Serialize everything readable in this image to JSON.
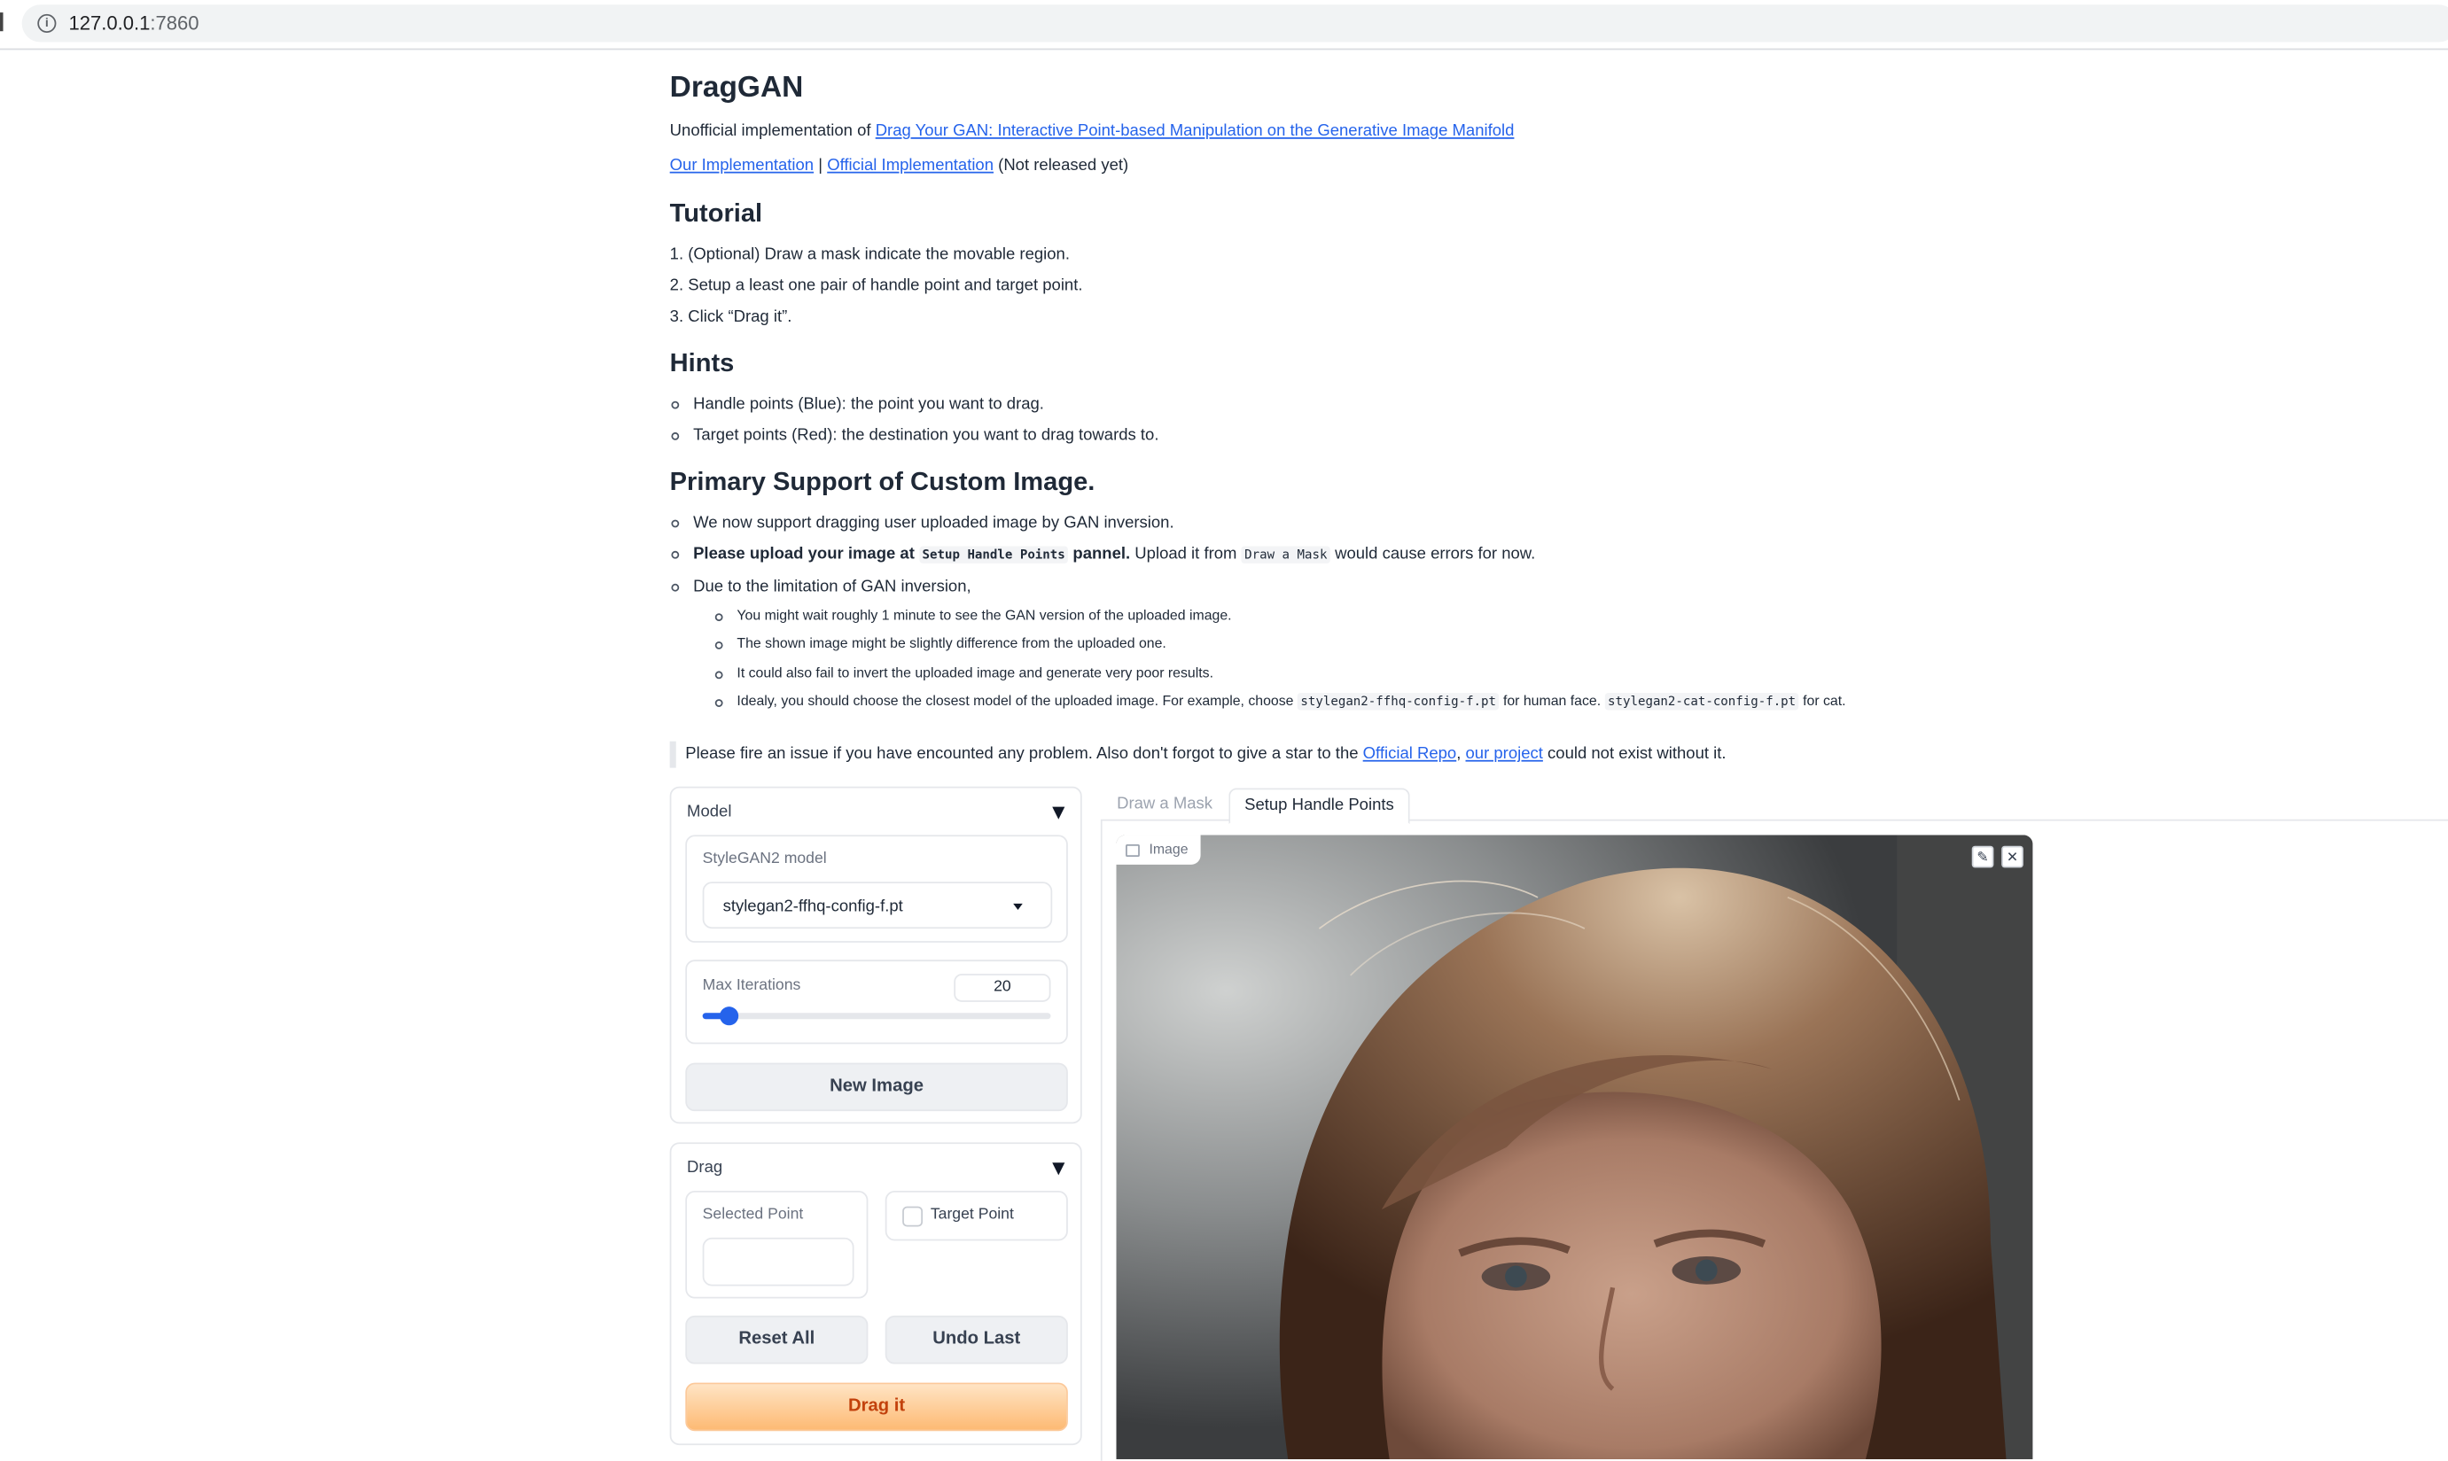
{
  "browser": {
    "url_host": "127.0.0.1",
    "url_port": ":7860"
  },
  "header": {
    "title": "DragGAN",
    "intro_prefix": "Unofficial implementation of ",
    "paper_link": "Drag Your GAN: Interactive Point-based Manipulation on the Generative Image Manifold",
    "our_impl_link": "Our Implementation",
    "separator": "|",
    "official_impl_link": "Official Implementation",
    "not_released": "(Not released yet)"
  },
  "tutorial": {
    "heading": "Tutorial",
    "steps": [
      "1. (Optional) Draw a mask indicate the movable region.",
      "2. Setup a least one pair of handle point and target point.",
      "3. Click “Drag it”."
    ]
  },
  "hints": {
    "heading": "Hints",
    "items": [
      "Handle points (Blue): the point you want to drag.",
      "Target points (Red): the destination you want to drag towards to."
    ]
  },
  "custom": {
    "heading": "Primary Support of Custom Image.",
    "item1": "We now support dragging user uploaded image by GAN inversion.",
    "item2_bold_prefix": "Please upload your image at ",
    "item2_code1": "Setup Handle Points",
    "item2_bold_suffix": " pannel.",
    "item2_text1": " Upload it from ",
    "item2_code2": "Draw a Mask",
    "item2_text2": " would cause errors for now.",
    "item3": "Due to the limitation of GAN inversion,",
    "sub1": "You might wait roughly 1 minute to see the GAN version of the uploaded image.",
    "sub2": "The shown image might be slightly difference from the uploaded one.",
    "sub3": "It could also fail to invert the uploaded image and generate very poor results.",
    "sub4_prefix": "Idealy, you should choose the closest model of the uploaded image. For example, choose ",
    "sub4_code1": "stylegan2-ffhq-config-f.pt",
    "sub4_mid": " for human face. ",
    "sub4_code2": "stylegan2-cat-config-f.pt",
    "sub4_suffix": " for cat."
  },
  "note": {
    "prefix": "Please fire an issue if you have encounted any problem. Also don't forgot to give a star to the ",
    "repo_link": "Official Repo",
    "comma": ", ",
    "project_link": "our project",
    "suffix": " could not exist without it."
  },
  "model_panel": {
    "title": "Model",
    "model_label": "StyleGAN2 model",
    "model_value": "stylegan2-ffhq-config-f.pt",
    "iterations_label": "Max Iterations",
    "iterations_value": "20",
    "iterations_fraction": 0.05,
    "new_image_button": "New Image"
  },
  "drag_panel": {
    "title": "Drag",
    "selected_point_label": "Selected Point",
    "selected_point_value": "",
    "target_point_label": "Target Point",
    "reset_button": "Reset All",
    "undo_button": "Undo Last",
    "drag_button": "Drag it"
  },
  "tabs": {
    "draw_mask": "Draw a Mask",
    "setup_handles": "Setup Handle Points"
  },
  "image": {
    "badge": "Image",
    "edit_icon": "pencil-icon",
    "close_icon": "close-icon"
  },
  "colors": {
    "accent_blue": "#2563eb",
    "drag_button_text": "#c2410c",
    "drag_button_bg": "#fdba74"
  }
}
